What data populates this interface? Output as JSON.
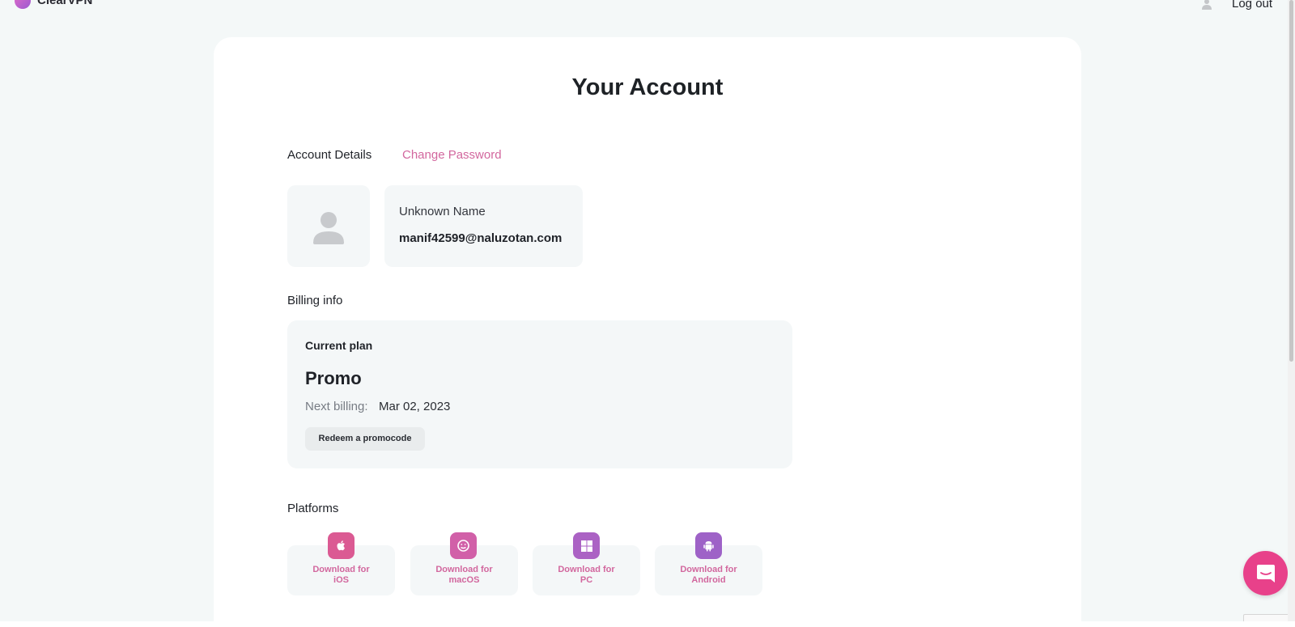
{
  "header": {
    "brand_name": "ClearVPN",
    "logout_label": "Log out"
  },
  "page": {
    "title": "Your Account"
  },
  "tabs": [
    {
      "label": "Account Details",
      "active": true
    },
    {
      "label": "Change Password",
      "active": false
    }
  ],
  "profile": {
    "name": "Unknown Name",
    "email": "manif42599@naluzotan.com"
  },
  "billing": {
    "section_label": "Billing info",
    "current_plan_label": "Current plan",
    "plan_name": "Promo",
    "next_billing_label": "Next billing:",
    "next_billing_date": "Mar 02, 2023",
    "redeem_label": "Redeem a promocode"
  },
  "platforms": {
    "section_label": "Platforms",
    "items": [
      {
        "line1": "Download for",
        "line2": "iOS",
        "icon": "apple-icon",
        "color": "#db5a93"
      },
      {
        "line1": "Download for",
        "line2": "macOS",
        "icon": "finder-icon",
        "color": "#d160a8"
      },
      {
        "line1": "Download for",
        "line2": "PC",
        "icon": "windows-icon",
        "color": "#ab62c4"
      },
      {
        "line1": "Download for",
        "line2": "Android",
        "icon": "android-icon",
        "color": "#9e62c7"
      }
    ]
  },
  "colors": {
    "accent_pink": "#d2679e",
    "chat_button": "#e8418a"
  }
}
